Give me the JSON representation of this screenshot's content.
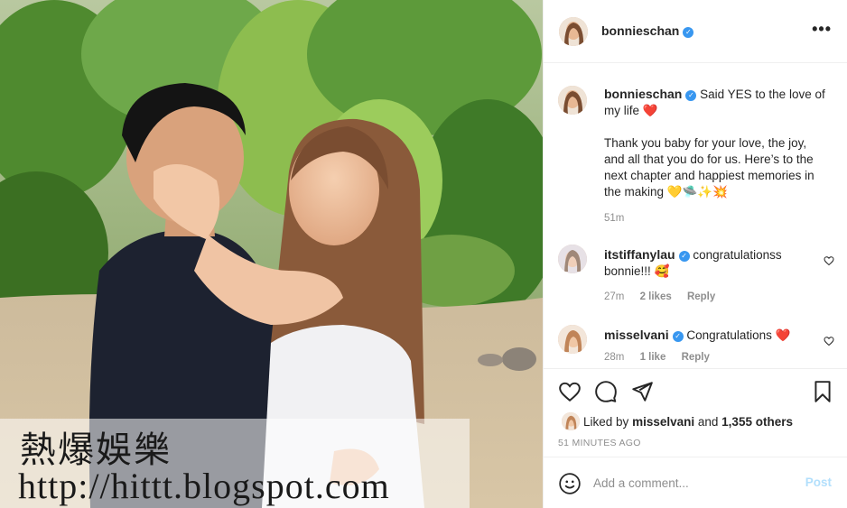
{
  "post": {
    "username": "bonnieschan",
    "more_icon": "more-horizontal-icon",
    "caption": {
      "username": "bonnieschan",
      "line1": "Said YES to the love of my life",
      "line1_emoji": "❤️",
      "line2": "Thank you baby for your love, the joy, and all that you do for us. Here’s to the next chapter and happiest memories in the making",
      "line2_emoji": "💛🛸✨💥",
      "time": "51m"
    },
    "comments": [
      {
        "username": "itstiffanylau",
        "text": "congratulationss bonnie!!!",
        "emoji": "🥰",
        "time": "27m",
        "likes": "2 likes",
        "reply": "Reply"
      },
      {
        "username": "misselvani",
        "text": "Congratulations",
        "emoji": "❤️",
        "time": "28m",
        "likes": "1 like",
        "reply": "Reply"
      }
    ],
    "liked_by_prefix": "Liked by",
    "liked_by_user": "misselvani",
    "liked_by_and": "and",
    "liked_by_others": "1,355 others",
    "timestamp": "51 MINUTES AGO",
    "comment_placeholder": "Add a comment...",
    "post_button": "Post"
  },
  "watermark": {
    "cn": "熱爆娛樂",
    "url": "http://hittt.blogspot.com"
  },
  "colors": {
    "verified": "#3897f0",
    "heart_red": "#ed4956",
    "post_disabled": "#b2dffc",
    "muted": "#8e8e8e"
  }
}
